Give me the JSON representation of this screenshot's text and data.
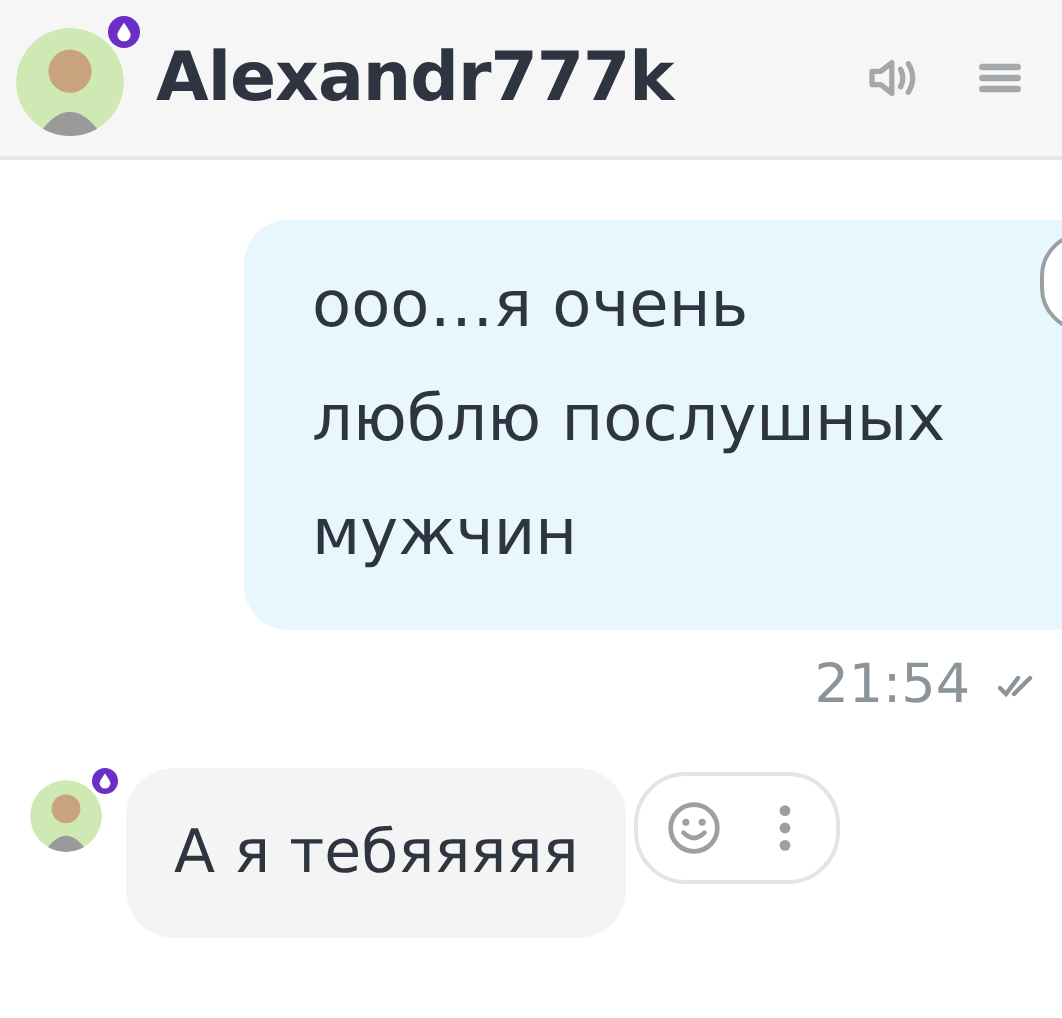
{
  "header": {
    "name": "Alexandr777k"
  },
  "messages": [
    {
      "kind": "outgoing",
      "text": "ооо…я очень люблю послушных мужчин",
      "time": "21:54",
      "read": true
    },
    {
      "kind": "incoming",
      "text": "А я тебяяяяя"
    }
  ]
}
